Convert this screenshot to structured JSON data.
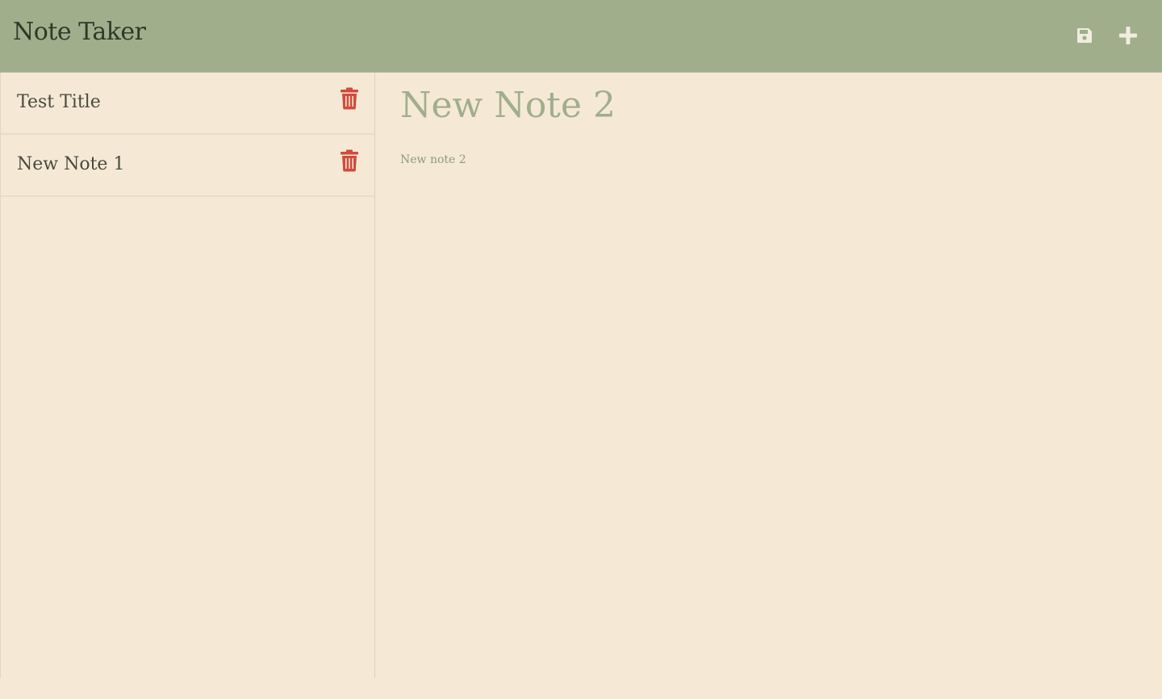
{
  "app": {
    "title": "Note Taker"
  },
  "toolbar": {
    "save_icon": "floppy-disk-icon",
    "add_icon": "plus-icon"
  },
  "notes": [
    {
      "title": "Test Title",
      "delete_icon": "trash-icon"
    },
    {
      "title": "New Note 1",
      "delete_icon": "trash-icon"
    }
  ],
  "editor": {
    "title_value": "New Note 2",
    "body_value": "New note 2"
  },
  "colors": {
    "navbar": "#a0ae8b",
    "background": "#f5e9d6",
    "delete": "#d04b3c",
    "icon_light": "#f2ecdf"
  }
}
